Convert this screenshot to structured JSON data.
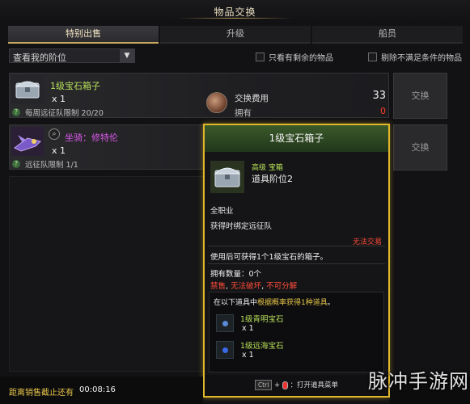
{
  "window": {
    "title": "物品交换"
  },
  "tabs": [
    {
      "label": "特别出售",
      "active": true
    },
    {
      "label": "升级",
      "active": false
    },
    {
      "label": "船员",
      "active": false
    }
  ],
  "filter": {
    "select_value": "查看我的阶位",
    "checkbox_remaining": {
      "label": "只看有剩余的物品",
      "checked": false
    },
    "checkbox_exclude": {
      "label": "剔除不满足条件的物品",
      "checked": false
    }
  },
  "items": [
    {
      "name": "1级宝石箱子",
      "qty": "x 1",
      "limit": "每周远征队限制 20/20",
      "icon": "chest-icon",
      "name_color": "#b8e05a"
    },
    {
      "name": "坐骑：修特伦",
      "qty": "x 1",
      "limit": "远征队限制 1/1",
      "icon": "mount-icon",
      "name_color": "#d858e8"
    }
  ],
  "exchange": {
    "button_label": "交换",
    "cost_label": "交换费用",
    "cost_value": "33",
    "own_label": "拥有",
    "own_value": "0"
  },
  "tooltip": {
    "title": "1级宝石箱子",
    "grade": "高级 宝箱",
    "level": "道具阶位2",
    "class": "全职业",
    "bind": "获得时绑定远征队",
    "no_trade": "无法交易",
    "description": "使用后可获得1个1级宝石的箱子。",
    "owned": "拥有数量：0个",
    "restrictions": [
      "禁售",
      "无法破坏",
      "不可分解"
    ],
    "reward_head_pre": "在以下道具中",
    "reward_head_hl": "根据概率获得1种道具",
    "reward_head_post": "。",
    "rewards": [
      {
        "name": "1级青明宝石",
        "qty": "x 1",
        "gem_color": "#5a8ad8"
      },
      {
        "name": "1级远海宝石",
        "qty": "x 1",
        "gem_color": "#3a6ae8"
      }
    ],
    "footer_key": "Ctrl",
    "footer_plus": "+",
    "footer_text": "：打开道具菜单"
  },
  "timer": {
    "label": "距离销售截止还有",
    "value": "00:08:16"
  },
  "watermark": "脉冲手游网",
  "colors": {
    "accent_gold": "#e0b62b",
    "uncommon_green": "#b8e05a",
    "epic_purple": "#d858e8",
    "warning_red": "#ff4b3a"
  }
}
